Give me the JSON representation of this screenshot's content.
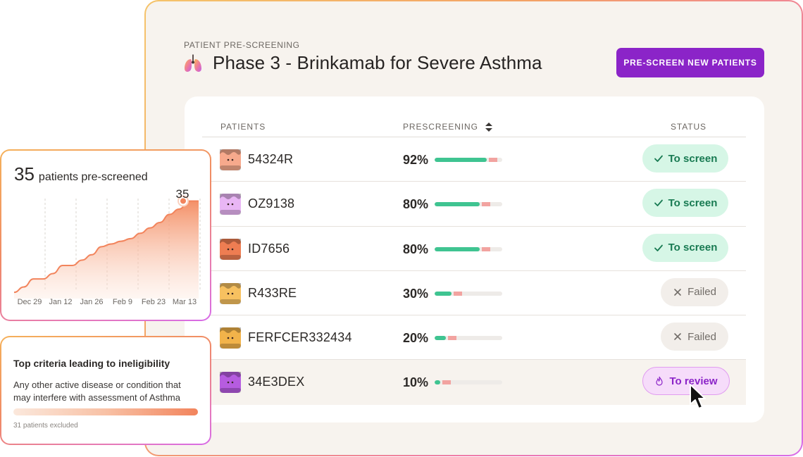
{
  "header": {
    "eyebrow": "PATIENT PRE-SCREENING",
    "title": "Phase 3 - Brinkamab for Severe Asthma",
    "title_icon": "lungs-icon",
    "primary_button": "PRE-SCREEN NEW PATIENTS"
  },
  "table": {
    "columns": {
      "patients": "PATIENTS",
      "prescreening": "PRESCREENING",
      "status": "STATUS"
    },
    "rows": [
      {
        "id": "54324R",
        "percent": "92%",
        "score": 0.92,
        "status": "To screen",
        "status_type": "screen",
        "avatar_color": "#f7a98c"
      },
      {
        "id": "OZ9138",
        "percent": "80%",
        "score": 0.8,
        "status": "To screen",
        "status_type": "screen",
        "avatar_color": "#e9b6f5"
      },
      {
        "id": "ID7656",
        "percent": "80%",
        "score": 0.8,
        "status": "To screen",
        "status_type": "screen",
        "avatar_color": "#ee7d52"
      },
      {
        "id": "R433RE",
        "percent": "30%",
        "score": 0.3,
        "status": "Failed",
        "status_type": "failed",
        "avatar_color": "#f7c160"
      },
      {
        "id": "FERFCER332434",
        "percent": "20%",
        "score": 0.2,
        "status": "Failed",
        "status_type": "failed",
        "avatar_color": "#f2b34a"
      },
      {
        "id": "34E3DEX",
        "percent": "10%",
        "score": 0.1,
        "status": "To review",
        "status_type": "review",
        "avatar_color": "#b65ce0"
      }
    ]
  },
  "summary": {
    "count": "35",
    "caption": "patients pre-screened",
    "peak_label": "35"
  },
  "chart_data": {
    "type": "area",
    "x_tick_labels": [
      "Dec 29",
      "Jan 12",
      "Jan 26",
      "Feb 9",
      "Feb 23",
      "Mar 13"
    ],
    "values": [
      1,
      3,
      6,
      6,
      8,
      11,
      11,
      13,
      15,
      18,
      19,
      20,
      21,
      23,
      25,
      27,
      30,
      32,
      35,
      35
    ],
    "ylim": [
      0,
      38
    ],
    "grid": "vertical dashed",
    "series_color": "#f2845c"
  },
  "criteria": {
    "title": "Top criteria leading to ineligibility",
    "description": "Any other active disease or condition that may interfere with assessment of Asthma",
    "footnote": "31 patients excluded"
  }
}
